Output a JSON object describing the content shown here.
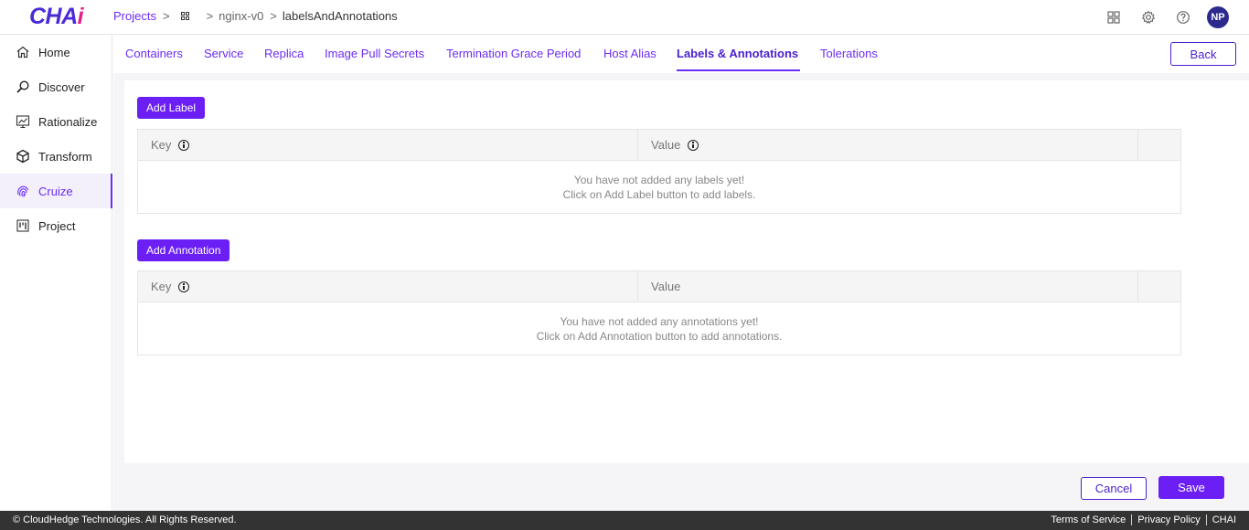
{
  "brand": {
    "logo_main": "CHA",
    "logo_accent": "i"
  },
  "breadcrumb": {
    "root": "Projects",
    "separator": ">",
    "app": "nginx-v0",
    "current": "labelsAndAnnotations"
  },
  "header_icons": [
    "apps-grid-icon",
    "gear-icon",
    "help-icon"
  ],
  "user": {
    "initials": "NP"
  },
  "sidebar": {
    "items": [
      {
        "label": "Home",
        "icon": "home-icon",
        "active": false
      },
      {
        "label": "Discover",
        "icon": "search-icon",
        "active": false
      },
      {
        "label": "Rationalize",
        "icon": "chart-icon",
        "active": false
      },
      {
        "label": "Transform",
        "icon": "cube-icon",
        "active": false
      },
      {
        "label": "Cruize",
        "icon": "fingerprint-icon",
        "active": true
      },
      {
        "label": "Project",
        "icon": "board-icon",
        "active": false
      }
    ]
  },
  "tabs": [
    {
      "label": "Containers"
    },
    {
      "label": "Service"
    },
    {
      "label": "Replica"
    },
    {
      "label": "Image Pull Secrets"
    },
    {
      "label": "Termination Grace Period"
    },
    {
      "label": "Host Alias"
    },
    {
      "label": "Labels & Annotations",
      "active": true
    },
    {
      "label": "Tolerations"
    }
  ],
  "back_label": "Back",
  "labels_section": {
    "add_button": "Add Label",
    "key_header": "Key",
    "value_header": "Value",
    "empty_line1": "You have not added any labels yet!",
    "empty_line2": "Click on Add Label button to add labels."
  },
  "annotations_section": {
    "add_button": "Add Annotation",
    "key_header": "Key",
    "value_header": "Value",
    "empty_line1": "You have not added any annotations yet!",
    "empty_line2": "Click on Add Annotation button to add annotations."
  },
  "actions": {
    "cancel": "Cancel",
    "save": "Save"
  },
  "footer": {
    "copyright": "© CloudHedge Technologies. All Rights Reserved.",
    "links": [
      "Terms of Service",
      "Privacy Policy",
      "CHAI"
    ]
  },
  "colors": {
    "accent": "#6b2cf5",
    "footer_bg": "#333333"
  }
}
